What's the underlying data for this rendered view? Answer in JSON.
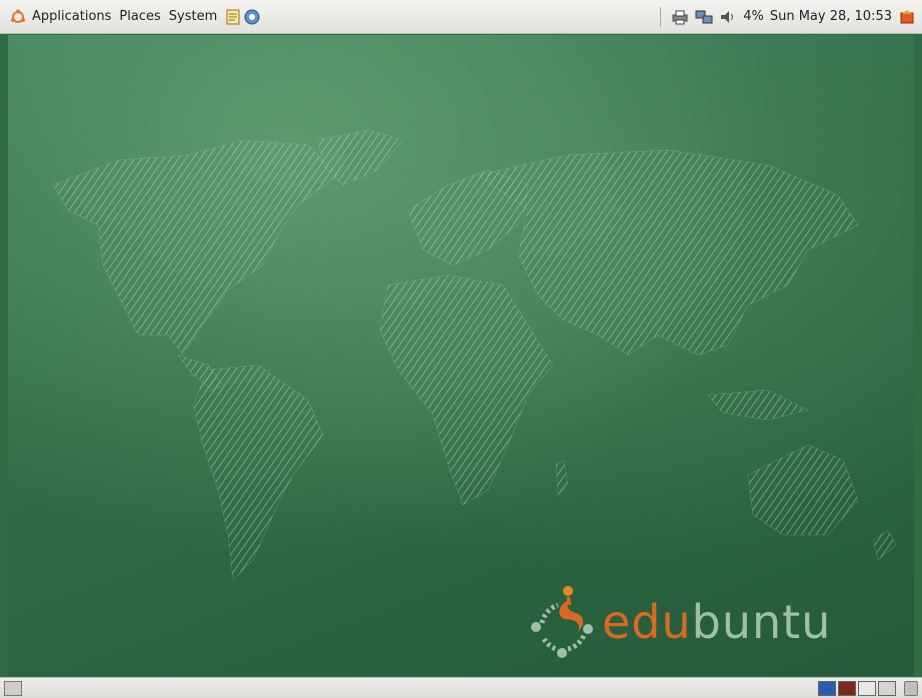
{
  "top_panel": {
    "menus": [
      "Applications",
      "Places",
      "System"
    ],
    "clock": "Sun May 28, 10:53",
    "volume_label": "4%"
  },
  "desktop": {
    "wallpaper": "world map chalkboard",
    "logo": {
      "prefix": "edu",
      "suffix": "buntu"
    }
  },
  "colors": {
    "chalkboard": "#2f6b45",
    "logo_orange": "#d96a22",
    "logo_green": "#9fbfaa"
  },
  "icons": [
    "ubuntu-logo-icon",
    "text-editor-icon",
    "help-icon",
    "printer-icon",
    "network-icon",
    "volume-icon",
    "logout-icon",
    "show-desktop-icon",
    "trash-icon"
  ]
}
